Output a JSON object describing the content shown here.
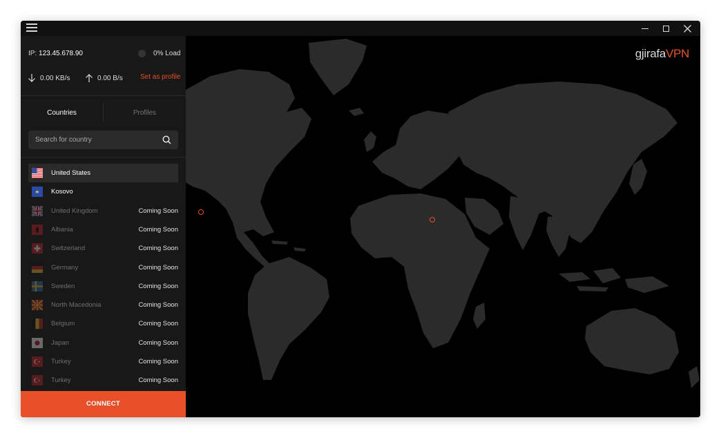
{
  "window": {
    "menu_icon": "hamburger-icon",
    "controls": [
      "minimize-icon",
      "maximize-icon",
      "close-icon"
    ]
  },
  "status": {
    "ip_label": "IP:",
    "ip_value": "123.45.678.90",
    "load": "0% Load",
    "download": "0.00 KB/s",
    "upload": "0.00 B/s",
    "set_profile": "Set as profile"
  },
  "tabs": {
    "countries": "Countries",
    "profiles": "Profiles"
  },
  "search": {
    "placeholder": "Search for country",
    "value": ""
  },
  "countries": [
    {
      "name": "United States",
      "status": "",
      "available": true,
      "selected": true,
      "flag": "us"
    },
    {
      "name": "Kosovo",
      "status": "",
      "available": true,
      "selected": false,
      "flag": "kosovo"
    },
    {
      "name": "United Kingdom",
      "status": "Coming Soon",
      "available": false,
      "flag": "uk"
    },
    {
      "name": "Albania",
      "status": "Coming Soon",
      "available": false,
      "flag": "albania"
    },
    {
      "name": "Switzerland",
      "status": "Coming Soon",
      "available": false,
      "flag": "switzerland"
    },
    {
      "name": "Germany",
      "status": "Coming Soon",
      "available": false,
      "flag": "germany"
    },
    {
      "name": "Sweden",
      "status": "Coming Soon",
      "available": false,
      "flag": "sweden"
    },
    {
      "name": "North Macedonia",
      "status": "Coming Soon",
      "available": false,
      "flag": "north-macedonia"
    },
    {
      "name": "Belgium",
      "status": "Coming Soon",
      "available": false,
      "flag": "belgium"
    },
    {
      "name": "Japan",
      "status": "Coming Soon",
      "available": false,
      "flag": "japan"
    },
    {
      "name": "Turkey",
      "status": "Coming Soon",
      "available": false,
      "flag": "turkey"
    },
    {
      "name": "Turkey",
      "status": "Coming Soon",
      "available": false,
      "flag": "turkey"
    }
  ],
  "connect_label": "CONNECT",
  "brand": {
    "part1": "gjirafa",
    "part2": "VPN"
  },
  "map": {
    "server_markers": [
      "United States",
      "Kosovo"
    ]
  },
  "colors": {
    "accent": "#e8502a",
    "sidebar": "#181818",
    "land": "#2b2b2b",
    "background": "#000000"
  }
}
